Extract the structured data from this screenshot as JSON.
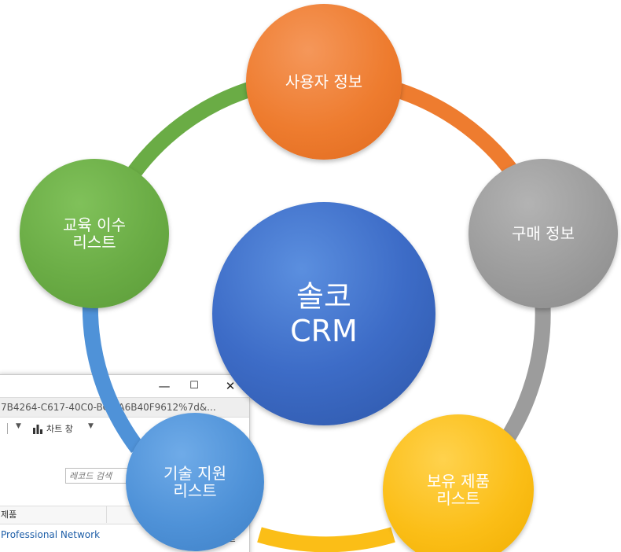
{
  "background_window": {
    "controls": {
      "minimize": "—",
      "maximize": "☐",
      "close": "✕"
    },
    "address_text": "7B4264-C617-40C0-BC5 A6B40F9612%7d&...",
    "toolbar": {
      "dropdown_arrow": "▼",
      "chart_label": "차트 창",
      "chart_dropdown_arrow": "▼"
    },
    "search_placeholder": "레코드 검색",
    "column_header": "제품",
    "row_text": "Professional Network",
    "edge_glyph": "끝"
  },
  "diagram": {
    "center": {
      "line1": "솔코",
      "line2": "CRM",
      "color": "#3d6cc7"
    },
    "nodes": [
      {
        "id": "top",
        "line1": "사용자 정보",
        "line2": "",
        "color": "#ee7c2f"
      },
      {
        "id": "right",
        "line1": "구매 정보",
        "line2": "",
        "color": "#9c9c9c"
      },
      {
        "id": "bottomright",
        "line1": "보유 제품",
        "line2": "리스트",
        "color": "#fbbe17"
      },
      {
        "id": "bottomleft",
        "line1": "기술 지원",
        "line2": "리스트",
        "color": "#4f92d8"
      },
      {
        "id": "left",
        "line1": "교육 이수",
        "line2": "리스트",
        "color": "#6aac45"
      }
    ]
  }
}
